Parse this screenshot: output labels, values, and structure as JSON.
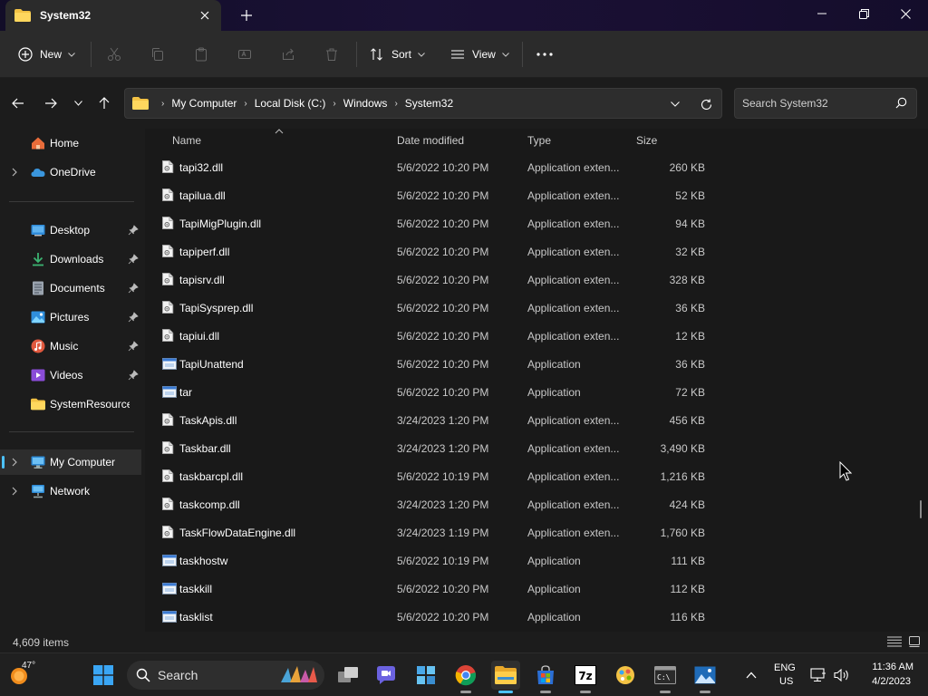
{
  "window": {
    "tab_title": "System32",
    "new_tab": "+",
    "controls": {
      "minimize": "—",
      "maximize": "❐",
      "close": "✕"
    }
  },
  "toolbar": {
    "new_label": "New",
    "sort_label": "Sort",
    "view_label": "View",
    "more": "•••"
  },
  "address": {
    "crumbs": [
      "My Computer",
      "Local Disk (C:)",
      "Windows",
      "System32"
    ],
    "search_placeholder": "Search System32"
  },
  "sidebar": {
    "items": [
      {
        "label": "Home",
        "icon": "home-icon",
        "pinned": false
      },
      {
        "label": "OneDrive",
        "icon": "cloud-icon",
        "pinned": false
      },
      {
        "label": "Desktop",
        "icon": "desktop-icon",
        "pinned": true
      },
      {
        "label": "Downloads",
        "icon": "download-icon",
        "pinned": true
      },
      {
        "label": "Documents",
        "icon": "document-icon",
        "pinned": true
      },
      {
        "label": "Pictures",
        "icon": "picture-icon",
        "pinned": true
      },
      {
        "label": "Music",
        "icon": "music-icon",
        "pinned": true
      },
      {
        "label": "Videos",
        "icon": "video-icon",
        "pinned": true
      },
      {
        "label": "SystemResources",
        "icon": "folder-icon",
        "pinned": false
      },
      {
        "label": "My Computer",
        "icon": "computer-icon",
        "pinned": false
      },
      {
        "label": "Network",
        "icon": "network-icon",
        "pinned": false
      }
    ]
  },
  "columns": {
    "name": "Name",
    "date": "Date modified",
    "type": "Type",
    "size": "Size"
  },
  "files": [
    {
      "name": "tapi32.dll",
      "date": "5/6/2022 10:20 PM",
      "type": "Application exten...",
      "size": "260 KB",
      "kind": "dll"
    },
    {
      "name": "tapilua.dll",
      "date": "5/6/2022 10:20 PM",
      "type": "Application exten...",
      "size": "52 KB",
      "kind": "dll"
    },
    {
      "name": "TapiMigPlugin.dll",
      "date": "5/6/2022 10:20 PM",
      "type": "Application exten...",
      "size": "94 KB",
      "kind": "dll"
    },
    {
      "name": "tapiperf.dll",
      "date": "5/6/2022 10:20 PM",
      "type": "Application exten...",
      "size": "32 KB",
      "kind": "dll"
    },
    {
      "name": "tapisrv.dll",
      "date": "5/6/2022 10:20 PM",
      "type": "Application exten...",
      "size": "328 KB",
      "kind": "dll"
    },
    {
      "name": "TapiSysprep.dll",
      "date": "5/6/2022 10:20 PM",
      "type": "Application exten...",
      "size": "36 KB",
      "kind": "dll"
    },
    {
      "name": "tapiui.dll",
      "date": "5/6/2022 10:20 PM",
      "type": "Application exten...",
      "size": "12 KB",
      "kind": "dll"
    },
    {
      "name": "TapiUnattend",
      "date": "5/6/2022 10:20 PM",
      "type": "Application",
      "size": "36 KB",
      "kind": "exe"
    },
    {
      "name": "tar",
      "date": "5/6/2022 10:20 PM",
      "type": "Application",
      "size": "72 KB",
      "kind": "exe"
    },
    {
      "name": "TaskApis.dll",
      "date": "3/24/2023 1:20 PM",
      "type": "Application exten...",
      "size": "456 KB",
      "kind": "dll"
    },
    {
      "name": "Taskbar.dll",
      "date": "3/24/2023 1:20 PM",
      "type": "Application exten...",
      "size": "3,490 KB",
      "kind": "dll"
    },
    {
      "name": "taskbarcpl.dll",
      "date": "5/6/2022 10:19 PM",
      "type": "Application exten...",
      "size": "1,216 KB",
      "kind": "dll"
    },
    {
      "name": "taskcomp.dll",
      "date": "3/24/2023 1:20 PM",
      "type": "Application exten...",
      "size": "424 KB",
      "kind": "dll"
    },
    {
      "name": "TaskFlowDataEngine.dll",
      "date": "3/24/2023 1:19 PM",
      "type": "Application exten...",
      "size": "1,760 KB",
      "kind": "dll"
    },
    {
      "name": "taskhostw",
      "date": "5/6/2022 10:19 PM",
      "type": "Application",
      "size": "111 KB",
      "kind": "exe"
    },
    {
      "name": "taskkill",
      "date": "5/6/2022 10:20 PM",
      "type": "Application",
      "size": "112 KB",
      "kind": "exe"
    },
    {
      "name": "tasklist",
      "date": "5/6/2022 10:20 PM",
      "type": "Application",
      "size": "116 KB",
      "kind": "exe"
    }
  ],
  "status": {
    "item_count": "4,609 items"
  },
  "taskbar": {
    "weather_temp": "47°",
    "search_label": "Search",
    "lang_line1": "ENG",
    "lang_line2": "US",
    "time": "11:36 AM",
    "date": "4/2/2023"
  },
  "colors": {
    "accent": "#4cc2ff",
    "folder": "#f3c244",
    "background": "#191919"
  }
}
